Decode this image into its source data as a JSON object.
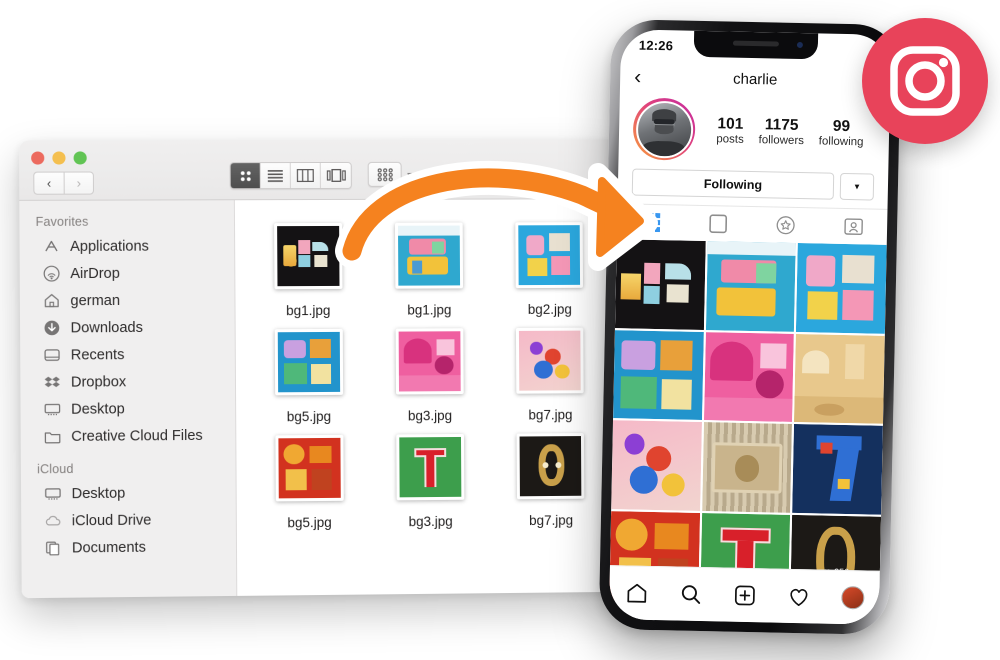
{
  "finder": {
    "window_title": "",
    "traffic_lights": [
      "close",
      "minimize",
      "zoom"
    ],
    "nav": {
      "back_label": "‹",
      "forward_label": "›"
    },
    "view_modes": [
      {
        "name": "icon-view",
        "selected": true
      },
      {
        "name": "list-view",
        "selected": false
      },
      {
        "name": "column-view",
        "selected": false
      },
      {
        "name": "gallery-view",
        "selected": false
      }
    ],
    "arrange_button": "group-items-icon",
    "sidebar": {
      "sections": [
        {
          "header": "Favorites",
          "items": [
            {
              "label": "Applications",
              "icon": "applications-icon"
            },
            {
              "label": "AirDrop",
              "icon": "airdrop-icon"
            },
            {
              "label": "german",
              "icon": "home-icon"
            },
            {
              "label": "Downloads",
              "icon": "downloads-icon"
            },
            {
              "label": "Recents",
              "icon": "recents-icon"
            },
            {
              "label": "Dropbox",
              "icon": "dropbox-icon"
            },
            {
              "label": "Desktop",
              "icon": "desktop-icon"
            },
            {
              "label": "Creative Cloud Files",
              "icon": "folder-icon"
            }
          ]
        },
        {
          "header": "iCloud",
          "items": [
            {
              "label": "Desktop",
              "icon": "desktop-icon"
            },
            {
              "label": "iCloud Drive",
              "icon": "cloud-icon"
            },
            {
              "label": "Documents",
              "icon": "documents-icon"
            }
          ]
        }
      ]
    },
    "files": [
      {
        "name": "bg1.jpg",
        "art": "dark-blocks"
      },
      {
        "name": "bg1.jpg",
        "art": "magazine-blue"
      },
      {
        "name": "bg2.jpg",
        "art": "clues-blue"
      },
      {
        "name": "bg5.jpg",
        "art": "posthunt-blue"
      },
      {
        "name": "bg3.jpg",
        "art": "pink-heart"
      },
      {
        "name": "bg7.jpg",
        "art": "pink-confetti"
      },
      {
        "name": "bg5.jpg",
        "art": "red-yellow"
      },
      {
        "name": "bg3.jpg",
        "art": "green-t"
      },
      {
        "name": "bg7.jpg",
        "art": "dark-s"
      }
    ]
  },
  "phone": {
    "status": {
      "time": "12:26"
    },
    "instagram": {
      "back_icon": "‹",
      "username": "charlie",
      "avatar": "profile-avatar",
      "stats": [
        {
          "value": "101",
          "label": "posts"
        },
        {
          "value": "1175",
          "label": "followers"
        },
        {
          "value": "99",
          "label": "following"
        }
      ],
      "follow_button": "Following",
      "follow_caret_icon": "▼",
      "tabs": [
        {
          "name": "grid-tab",
          "icon": "grid-icon",
          "active": true
        },
        {
          "name": "reels-tab",
          "icon": "frame-icon",
          "active": false
        },
        {
          "name": "guides-tab",
          "icon": "star-icon",
          "active": false
        },
        {
          "name": "tagged-tab",
          "icon": "tagged-person-icon",
          "active": false
        }
      ],
      "grid": [
        {
          "art": "dark-blocks",
          "likes": ""
        },
        {
          "art": "magazine-blue",
          "likes": ""
        },
        {
          "art": "clues-blue",
          "likes": ""
        },
        {
          "art": "posthunt-blue",
          "likes": ""
        },
        {
          "art": "pink-heart",
          "likes": ""
        },
        {
          "art": "tan-castle",
          "likes": ""
        },
        {
          "art": "pink-confetti",
          "likes": ""
        },
        {
          "art": "gold-nine",
          "likes": ""
        },
        {
          "art": "navy-seven",
          "likes": ""
        },
        {
          "art": "red-yellow",
          "likes": ""
        },
        {
          "art": "green-t",
          "likes": ""
        },
        {
          "art": "dark-s",
          "likes": "256"
        }
      ],
      "bottom_nav": [
        {
          "name": "home-nav",
          "icon": "home-icon"
        },
        {
          "name": "search-nav",
          "icon": "search-icon"
        },
        {
          "name": "add-nav",
          "icon": "plus-square-icon"
        },
        {
          "name": "activity-nav",
          "icon": "heart-icon"
        },
        {
          "name": "profile-nav",
          "icon": "avatar-icon"
        }
      ]
    }
  },
  "badge": {
    "icon": "instagram-logo-icon",
    "color": "#e8435a"
  },
  "arrow": {
    "name": "transfer-arrow",
    "color": "#f5821f"
  }
}
